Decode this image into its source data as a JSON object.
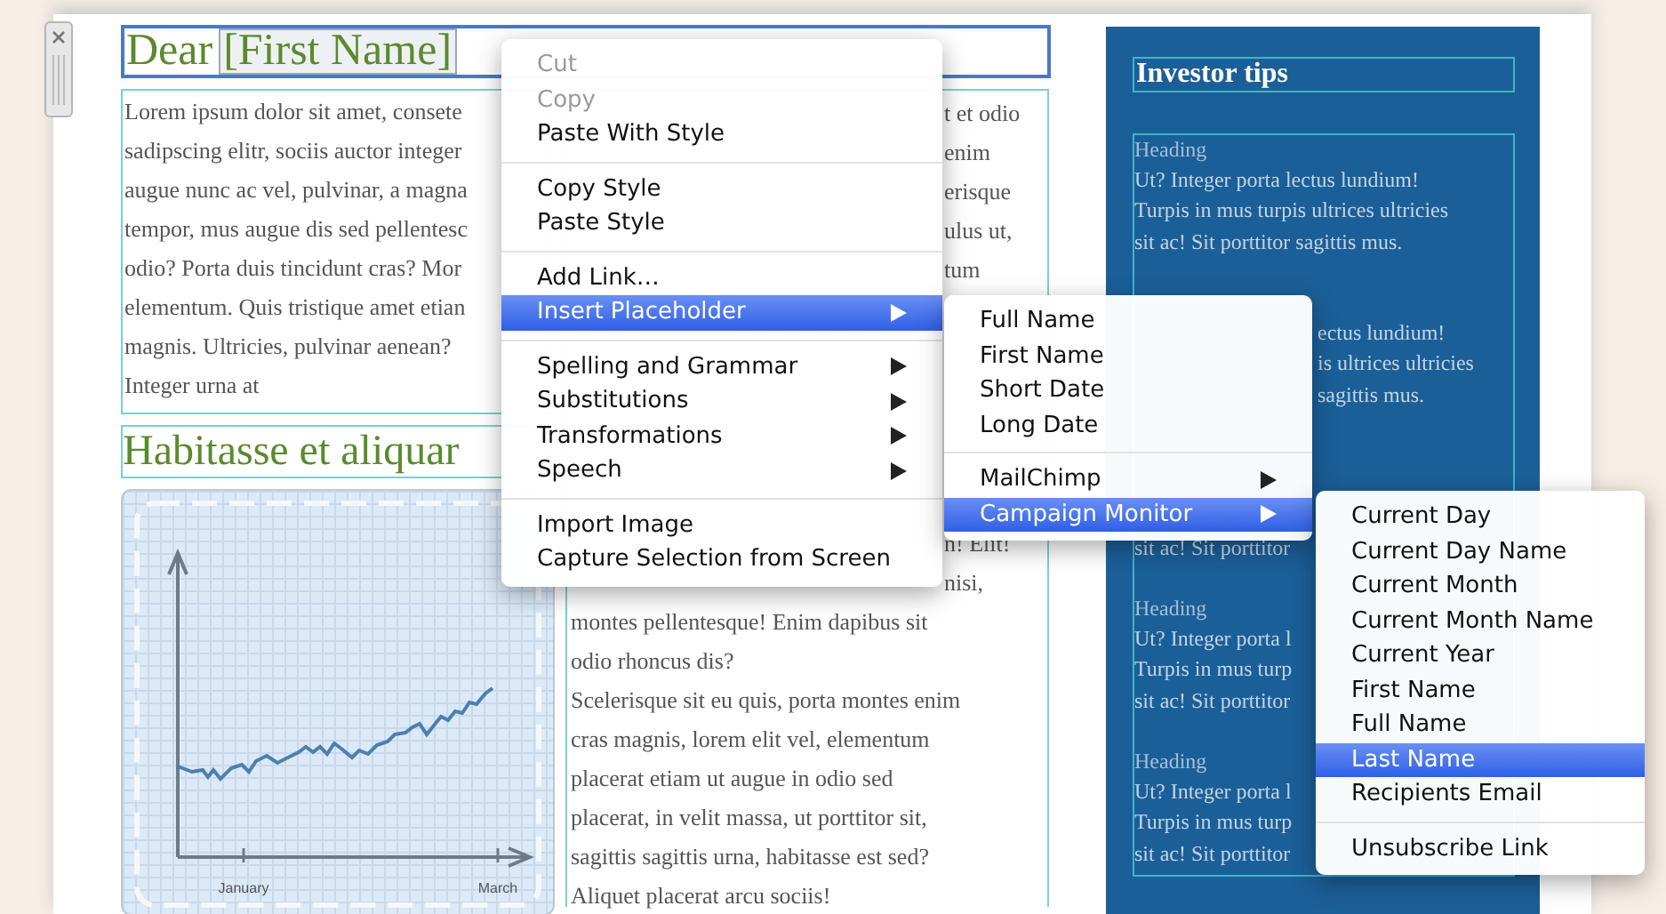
{
  "document": {
    "greeting": {
      "salutation": "Dear",
      "placeholder": "[First Name]"
    },
    "left_paragraph_lines": [
      "Lorem ipsum dolor sit amet, consete",
      "sadipscing elitr, sociis auctor integer",
      "augue nunc ac vel, pulvinar, a magna",
      "tempor, mus augue dis sed pellentesc",
      "odio? Porta duis tincidunt cras? Mor",
      "elementum. Quis tristique amet etian",
      "magnis. Ultricies, pulvinar aenean?",
      "Integer urna at"
    ],
    "subheading": "Habitasse et aliquar",
    "chart_labels": [
      "January",
      "March"
    ],
    "middle_top_fragments": [
      "t et odio",
      "enim",
      "erisque",
      "ulus ut,",
      "tum"
    ],
    "middle_mid_fragments": [
      "n! Elit!",
      "nisi,"
    ],
    "middle_lines": [
      "montes pellentesque! Enim dapibus sit",
      "odio rhoncus dis?",
      "Scelerisque sit eu quis, porta montes enim",
      "cras magnis, lorem elit vel, elementum",
      "placerat etiam ut augue in odio sed",
      "placerat, in velit massa, ut porttitor sit,",
      "sagittis sagittis urna, habitasse est sed?",
      "Aliquet placerat arcu sociis!"
    ]
  },
  "sidebar": {
    "title": "Investor tips",
    "blocks": [
      {
        "heading": "Heading",
        "lines": [
          "Ut? Integer porta lectus lundium!",
          "Turpis in mus turpis ultrices ultricies",
          "sit ac! Sit porttitor sagittis mus."
        ]
      },
      {
        "lines": [
          "ectus lundium!",
          "is ultrices ultricies",
          "sagittis mus."
        ]
      },
      {
        "lines": [
          "sit ac! Sit porttitor"
        ]
      },
      {
        "heading": "Heading",
        "lines": [
          "Ut? Integer porta l",
          "Turpis in mus turp",
          "sit ac! Sit porttitor"
        ]
      },
      {
        "heading": "Heading",
        "lines": [
          "Ut? Integer porta l",
          "Turpis in mus turp",
          "sit ac! Sit porttitor"
        ]
      }
    ]
  },
  "menus": [
    {
      "items": [
        {
          "kind": "item",
          "label": "Cut",
          "disabled": true,
          "selected": false,
          "submenu": false
        },
        {
          "kind": "item",
          "label": "Copy",
          "disabled": true,
          "selected": false,
          "submenu": false
        },
        {
          "kind": "item",
          "label": "Paste With Style",
          "disabled": false,
          "selected": false,
          "submenu": false
        },
        {
          "kind": "separator"
        },
        {
          "kind": "item",
          "label": "Copy Style",
          "disabled": false,
          "selected": false,
          "submenu": false
        },
        {
          "kind": "item",
          "label": "Paste Style",
          "disabled": false,
          "selected": false,
          "submenu": false
        },
        {
          "kind": "separator"
        },
        {
          "kind": "item",
          "label": "Add Link…",
          "disabled": false,
          "selected": false,
          "submenu": false
        },
        {
          "kind": "item",
          "label": "Insert Placeholder",
          "disabled": false,
          "selected": true,
          "submenu": true
        },
        {
          "kind": "separator"
        },
        {
          "kind": "item",
          "label": "Spelling and Grammar",
          "disabled": false,
          "selected": false,
          "submenu": true
        },
        {
          "kind": "item",
          "label": "Substitutions",
          "disabled": false,
          "selected": false,
          "submenu": true
        },
        {
          "kind": "item",
          "label": "Transformations",
          "disabled": false,
          "selected": false,
          "submenu": true
        },
        {
          "kind": "item",
          "label": "Speech",
          "disabled": false,
          "selected": false,
          "submenu": true
        },
        {
          "kind": "separator"
        },
        {
          "kind": "item",
          "label": "Import Image",
          "disabled": false,
          "selected": false,
          "submenu": false
        },
        {
          "kind": "item",
          "label": "Capture Selection from Screen",
          "disabled": false,
          "selected": false,
          "submenu": false
        }
      ]
    },
    {
      "items": [
        {
          "kind": "item",
          "label": "Full Name",
          "disabled": false,
          "selected": false,
          "submenu": false
        },
        {
          "kind": "item",
          "label": "First Name",
          "disabled": false,
          "selected": false,
          "submenu": false
        },
        {
          "kind": "item",
          "label": "Short Date",
          "disabled": false,
          "selected": false,
          "submenu": false
        },
        {
          "kind": "item",
          "label": "Long Date",
          "disabled": false,
          "selected": false,
          "submenu": false
        },
        {
          "kind": "separator"
        },
        {
          "kind": "item",
          "label": "MailChimp",
          "disabled": false,
          "selected": false,
          "submenu": true
        },
        {
          "kind": "item",
          "label": "Campaign Monitor",
          "disabled": false,
          "selected": true,
          "submenu": true
        }
      ]
    },
    {
      "items": [
        {
          "kind": "item",
          "label": "Current Day",
          "disabled": false,
          "selected": false,
          "submenu": false
        },
        {
          "kind": "item",
          "label": "Current Day Name",
          "disabled": false,
          "selected": false,
          "submenu": false
        },
        {
          "kind": "item",
          "label": "Current Month",
          "disabled": false,
          "selected": false,
          "submenu": false
        },
        {
          "kind": "item",
          "label": "Current Month Name",
          "disabled": false,
          "selected": false,
          "submenu": false
        },
        {
          "kind": "item",
          "label": "Current Year",
          "disabled": false,
          "selected": false,
          "submenu": false
        },
        {
          "kind": "item",
          "label": "First Name",
          "disabled": false,
          "selected": false,
          "submenu": false
        },
        {
          "kind": "item",
          "label": "Full Name",
          "disabled": false,
          "selected": false,
          "submenu": false
        },
        {
          "kind": "item",
          "label": "Last Name",
          "disabled": false,
          "selected": true,
          "submenu": false
        },
        {
          "kind": "item",
          "label": "Recipients Email",
          "disabled": false,
          "selected": false,
          "submenu": false
        },
        {
          "kind": "separator"
        },
        {
          "kind": "item",
          "label": "Unsubscribe Link",
          "disabled": false,
          "selected": false,
          "submenu": false
        }
      ]
    }
  ]
}
